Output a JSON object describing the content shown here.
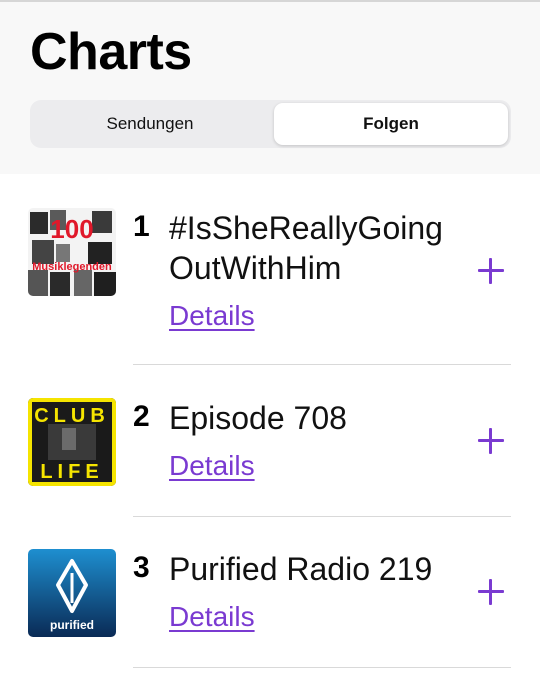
{
  "header": {
    "title": "Charts",
    "segments": [
      "Sendungen",
      "Folgen"
    ],
    "selected_segment": "Folgen"
  },
  "accent_color": "#7a3ad1",
  "items": [
    {
      "rank": "1",
      "title_line1": "#IsSheReallyGoing",
      "title_line2": "OutWithHim",
      "details_label": "Details",
      "artwork": {
        "number": "100",
        "text": "Musiklegenden"
      }
    },
    {
      "rank": "2",
      "title_line1": "Episode 708",
      "details_label": "Details",
      "artwork": {
        "text_top": "CLUB",
        "text_bottom": "LIFE"
      }
    },
    {
      "rank": "3",
      "title_line1": "Purified Radio 219",
      "details_label": "Details",
      "artwork": {
        "text": "purified"
      }
    }
  ]
}
